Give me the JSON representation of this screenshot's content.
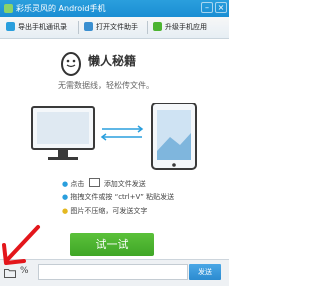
{
  "window": {
    "title": "彩乐灵风的 Android手机"
  },
  "toolbar": {
    "export_contacts": "导出手机通讯录",
    "open_folder": "打开文件助手",
    "upgrade_apps": "升级手机应用"
  },
  "hero": {
    "title": "懒人秘籍",
    "subtitle": "无需数据线，轻松传文件。"
  },
  "tips": {
    "click_prefix": "点击",
    "click_suffix": "添加文件发送",
    "drag_line": "拖拽文件或按 “ctrl+V” 粘贴发送",
    "image_line": "图片不压缩，可发送文字"
  },
  "main": {
    "try_button": "试一试"
  },
  "bottom": {
    "send_label": "发送",
    "input_placeholder": ""
  },
  "colors": {
    "accent": "#2a9fdd",
    "green": "#4cb431",
    "arrow": "#e3161b"
  },
  "icons": {
    "folder": "folder-icon",
    "emoji": "percent-icon",
    "bulb": "bulb-icon",
    "arrow": "red-arrow-annotation"
  }
}
